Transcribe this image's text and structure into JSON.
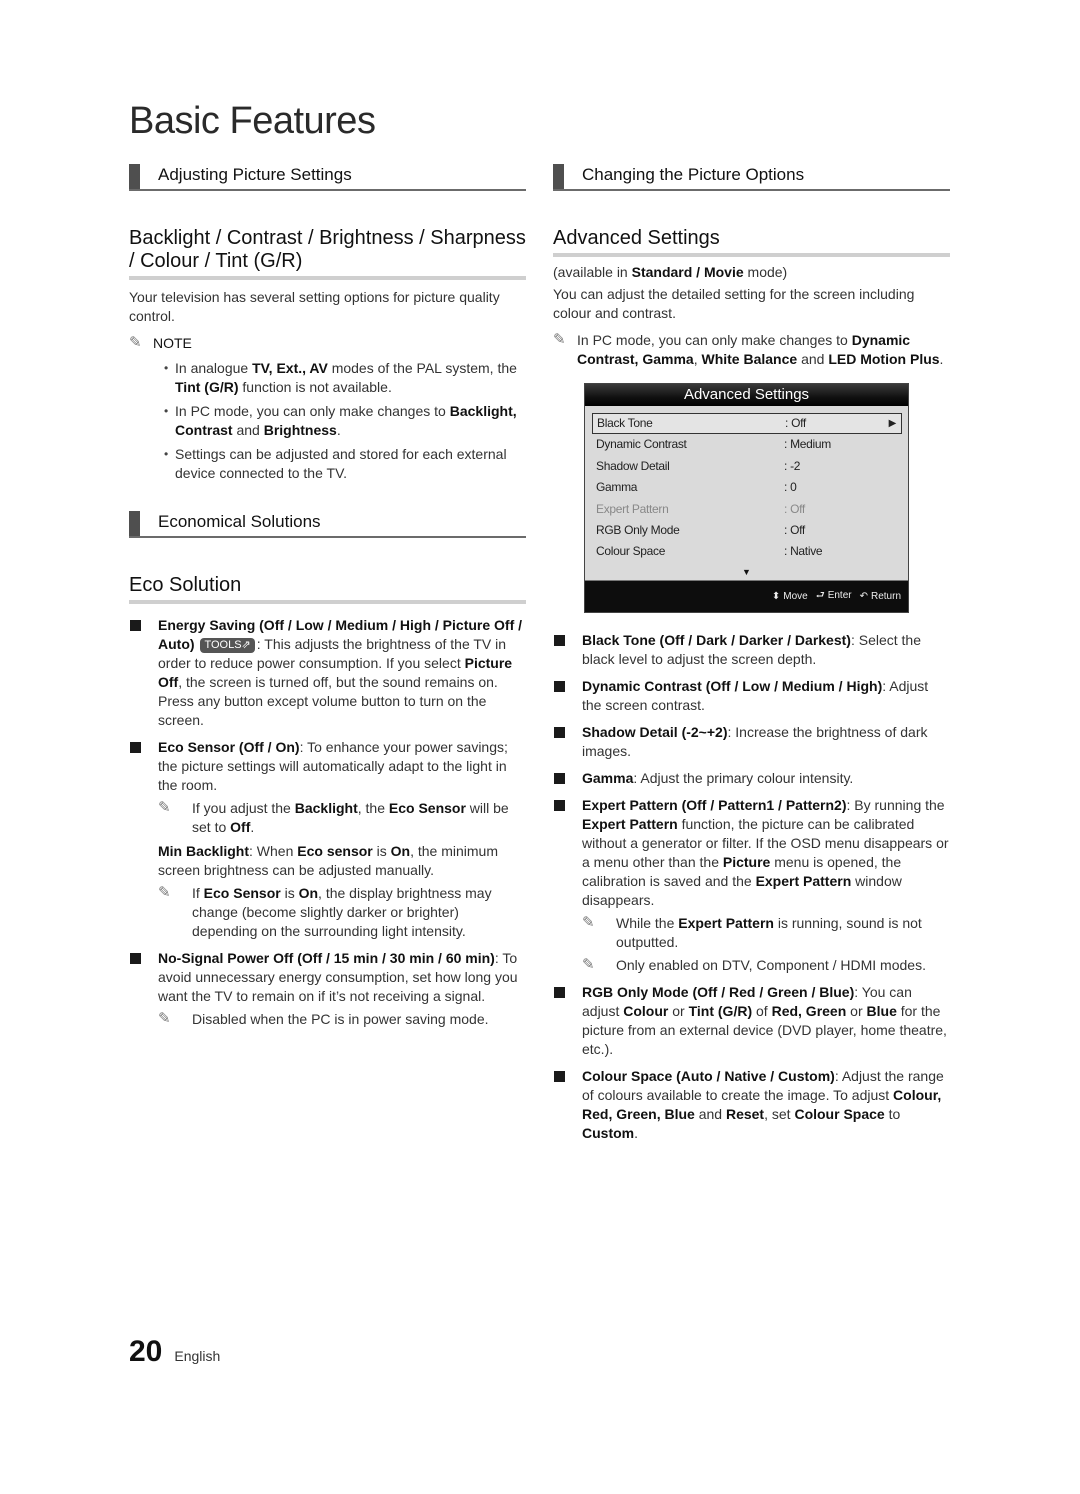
{
  "page": {
    "title": "Basic Features",
    "page_number": "20",
    "language": "English"
  },
  "left": {
    "section1": {
      "heading": "Adjusting Picture Settings",
      "subheading": "Backlight / Contrast / Brightness / Sharpness / Colour / Tint (G/R)",
      "intro": "Your television has several setting options for picture quality control.",
      "note_label": "NOTE",
      "bullets": [
        {
          "parts": [
            [
              "t",
              "In analogue "
            ],
            [
              "b",
              "TV, Ext., AV"
            ],
            [
              "t",
              " modes of the PAL system, the "
            ],
            [
              "b",
              "Tint (G/R)"
            ],
            [
              "t",
              " function is not available."
            ]
          ]
        },
        {
          "parts": [
            [
              "t",
              "In PC mode, you can only make changes to "
            ],
            [
              "b",
              "Backlight, Contrast"
            ],
            [
              "t",
              " and "
            ],
            [
              "b",
              "Brightness"
            ],
            [
              "t",
              "."
            ]
          ]
        },
        {
          "parts": [
            [
              "t",
              "Settings can be adjusted and stored for each external device connected to the TV."
            ]
          ]
        }
      ]
    },
    "section2": {
      "heading": "Economical Solutions",
      "subheading": "Eco Solution",
      "items": [
        {
          "parts": [
            [
              "b",
              "Energy Saving (Off / Low / Medium / High / Picture Off / Auto)"
            ],
            [
              "t",
              " "
            ],
            [
              "badge",
              "TOOLS⇗"
            ],
            [
              "t",
              ": This adjusts the brightness of the TV in order to reduce power consumption. If you select "
            ],
            [
              "b",
              "Picture Off"
            ],
            [
              "t",
              ", the screen is turned off, but the sound remains on. Press any button except volume button to turn on the screen."
            ]
          ],
          "notes": [],
          "extra": null
        },
        {
          "parts": [
            [
              "b",
              "Eco Sensor (Off / On)"
            ],
            [
              "t",
              ": To enhance your power savings; the picture settings will automatically adapt to the light in the room."
            ]
          ],
          "notes": [
            {
              "parts": [
                [
                  "t",
                  "If you adjust the "
                ],
                [
                  "b",
                  "Backlight"
                ],
                [
                  "t",
                  ", the "
                ],
                [
                  "b",
                  "Eco Sensor"
                ],
                [
                  "t",
                  " will be set to "
                ],
                [
                  "b",
                  "Off"
                ],
                [
                  "t",
                  "."
                ]
              ]
            }
          ],
          "extra": {
            "parts": [
              [
                "b",
                "Min Backlight"
              ],
              [
                "t",
                ": When "
              ],
              [
                "b",
                "Eco sensor"
              ],
              [
                "t",
                " is "
              ],
              [
                "b",
                "On"
              ],
              [
                "t",
                ", the minimum screen brightness can be adjusted manually."
              ]
            ],
            "notes": [
              {
                "parts": [
                  [
                    "t",
                    "If "
                  ],
                  [
                    "b",
                    "Eco Sensor"
                  ],
                  [
                    "t",
                    " is "
                  ],
                  [
                    "b",
                    "On"
                  ],
                  [
                    "t",
                    ", the display brightness may change (become slightly darker or brighter) depending on the surrounding light intensity."
                  ]
                ]
              }
            ]
          }
        },
        {
          "parts": [
            [
              "b",
              "No-Signal Power Off (Off / 15 min / 30 min / 60 min)"
            ],
            [
              "t",
              ": To avoid unnecessary energy consumption, set how long you want the TV to remain on if it’s not receiving a signal."
            ]
          ],
          "notes": [
            {
              "parts": [
                [
                  "t",
                  "Disabled when the PC is in power saving mode."
                ]
              ]
            }
          ],
          "extra": null
        }
      ]
    }
  },
  "right": {
    "heading": "Changing the Picture Options",
    "subheading": "Advanced Settings",
    "availability": [
      [
        "t",
        "(available in "
      ],
      [
        "b",
        "Standard / Movie"
      ],
      [
        "t",
        " mode)"
      ]
    ],
    "intro": "You can adjust the detailed setting for the screen including colour and contrast.",
    "pc_note": [
      [
        "t",
        "In PC mode, you can only make changes to "
      ],
      [
        "b",
        "Dynamic Contrast, Gamma"
      ],
      [
        "t",
        ", "
      ],
      [
        "b",
        "White Balance"
      ],
      [
        "t",
        " and "
      ],
      [
        "b",
        "LED Motion Plus"
      ],
      [
        "t",
        "."
      ]
    ],
    "osd": {
      "title": "Advanced Settings",
      "rows": [
        {
          "label": "Black Tone",
          "value": ": Off",
          "selected": true,
          "disabled": false
        },
        {
          "label": "Dynamic Contrast",
          "value": ": Medium",
          "selected": false,
          "disabled": false
        },
        {
          "label": "Shadow Detail",
          "value": ": -2",
          "selected": false,
          "disabled": false
        },
        {
          "label": "Gamma",
          "value": ": 0",
          "selected": false,
          "disabled": false
        },
        {
          "label": "Expert Pattern",
          "value": ": Off",
          "selected": false,
          "disabled": true
        },
        {
          "label": "RGB Only Mode",
          "value": ": Off",
          "selected": false,
          "disabled": false
        },
        {
          "label": "Colour Space",
          "value": ": Native",
          "selected": false,
          "disabled": false
        }
      ],
      "more_indicator": "▼",
      "select_arrow": "▶",
      "footer": {
        "move_icon": "⬍",
        "move": "Move",
        "enter_icon": "⮐",
        "enter": "Enter",
        "return_icon": "↶",
        "return": "Return"
      }
    },
    "items": [
      {
        "parts": [
          [
            "b",
            "Black Tone (Off / Dark / Darker / Darkest)"
          ],
          [
            "t",
            ": Select the black level to adjust the screen depth."
          ]
        ],
        "notes": []
      },
      {
        "parts": [
          [
            "b",
            "Dynamic Contrast (Off / Low / Medium / High)"
          ],
          [
            "t",
            ": Adjust the screen contrast."
          ]
        ],
        "notes": []
      },
      {
        "parts": [
          [
            "b",
            "Shadow Detail (-2~+2)"
          ],
          [
            "t",
            ": Increase the brightness of dark images."
          ]
        ],
        "notes": []
      },
      {
        "parts": [
          [
            "b",
            "Gamma"
          ],
          [
            "t",
            ": Adjust the primary colour intensity."
          ]
        ],
        "notes": []
      },
      {
        "parts": [
          [
            "b",
            "Expert Pattern (Off / Pattern1 / Pattern2)"
          ],
          [
            "t",
            ": By running the "
          ],
          [
            "b",
            "Expert Pattern"
          ],
          [
            "t",
            " function, the picture can be calibrated without a generator or filter. If the OSD menu disappears or a menu other than the "
          ],
          [
            "b",
            "Picture"
          ],
          [
            "t",
            " menu is opened, the calibration is saved and the "
          ],
          [
            "b",
            "Expert Pattern"
          ],
          [
            "t",
            " window disappears."
          ]
        ],
        "notes": [
          {
            "parts": [
              [
                "t",
                "While the "
              ],
              [
                "b",
                "Expert Pattern"
              ],
              [
                "t",
                " is running, sound is not outputted."
              ]
            ]
          },
          {
            "parts": [
              [
                "t",
                "Only enabled on DTV, Component / HDMI modes."
              ]
            ]
          }
        ]
      },
      {
        "parts": [
          [
            "b",
            "RGB Only Mode (Off / Red / Green / Blue)"
          ],
          [
            "t",
            ": You can adjust "
          ],
          [
            "b",
            "Colour"
          ],
          [
            "t",
            " or "
          ],
          [
            "b",
            "Tint (G/R)"
          ],
          [
            "t",
            " of "
          ],
          [
            "b",
            "Red, Green"
          ],
          [
            "t",
            " or "
          ],
          [
            "b",
            "Blue"
          ],
          [
            "t",
            " for the picture from an external device (DVD player, home theatre, etc.)."
          ]
        ],
        "notes": []
      },
      {
        "parts": [
          [
            "b",
            "Colour Space (Auto / Native / Custom)"
          ],
          [
            "t",
            ": Adjust the range of colours available to create the image. To adjust "
          ],
          [
            "b",
            "Colour, Red, Green, Blue"
          ],
          [
            "t",
            " and "
          ],
          [
            "b",
            "Reset"
          ],
          [
            "t",
            ", set "
          ],
          [
            "b",
            "Colour Space"
          ],
          [
            "t",
            " to "
          ],
          [
            "b",
            "Custom"
          ],
          [
            "t",
            "."
          ]
        ],
        "notes": []
      }
    ]
  },
  "icons": {
    "pencil": "✎",
    "bullet_dot": "•"
  }
}
